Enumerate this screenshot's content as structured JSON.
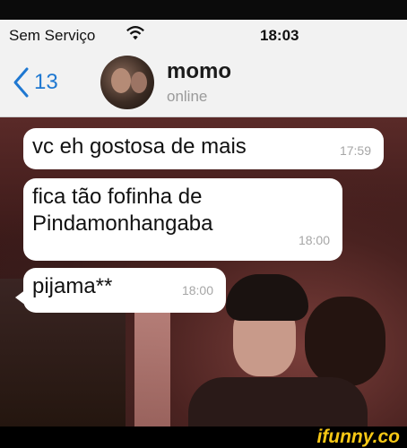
{
  "status_bar": {
    "carrier": "Sem Serviço",
    "time": "18:03",
    "wifi_icon": "wifi-icon"
  },
  "navbar": {
    "back_count": "13",
    "back_icon": "chevron-left-icon",
    "contact_name": "momo",
    "contact_status": "online",
    "accent_color": "#1f78d1"
  },
  "messages": [
    {
      "text": "vc eh gostosa de mais",
      "time": "17:59"
    },
    {
      "text_line1": "fica tão fofinha de",
      "text_line2": "Pindamonhangaba",
      "time": "18:00"
    },
    {
      "text": "pijama**",
      "time": "18:00"
    }
  ],
  "watermark": "ifunny.co"
}
